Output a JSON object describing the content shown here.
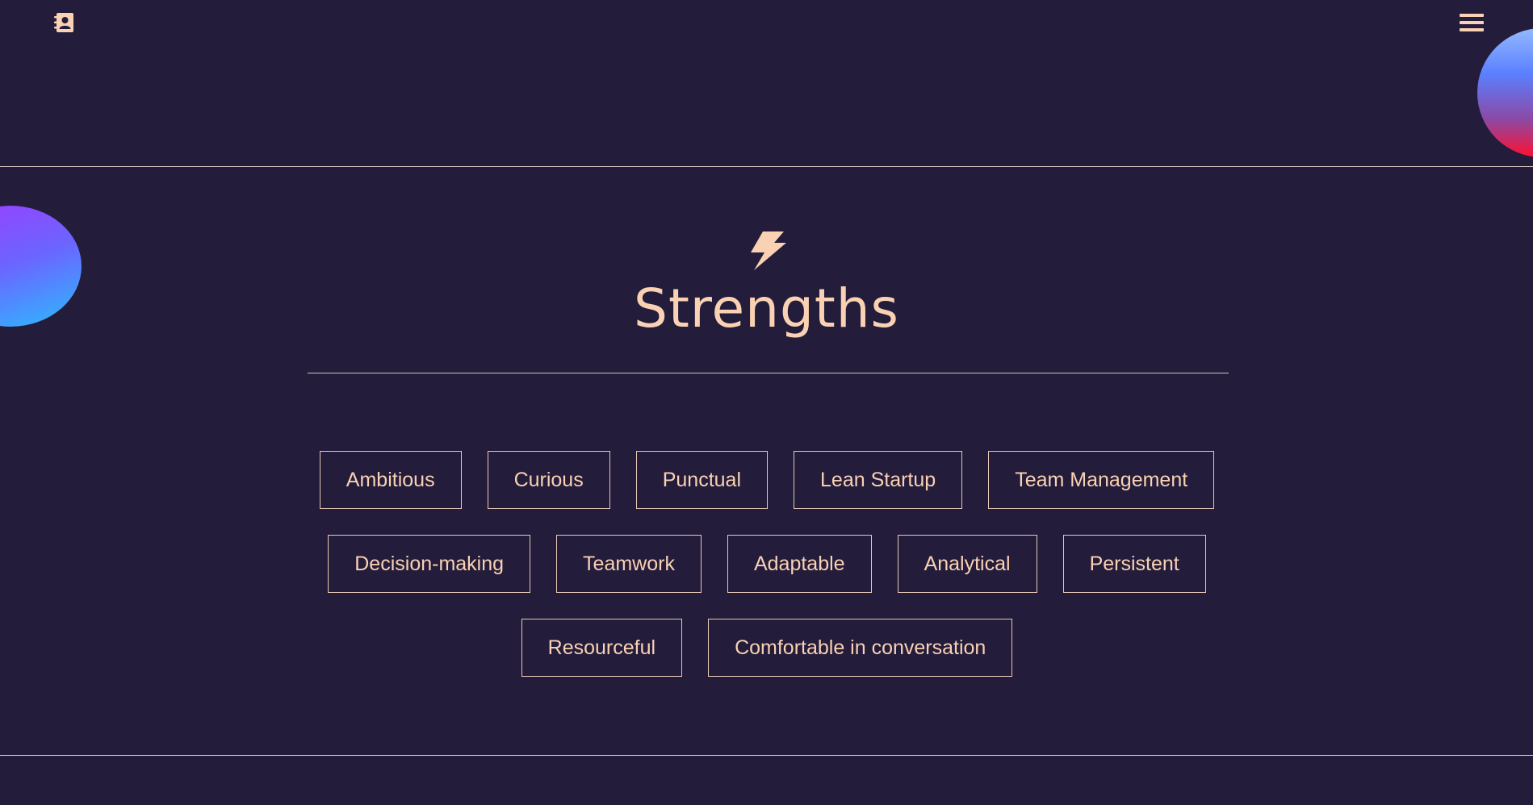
{
  "header": {
    "contacts_icon": "contact-book-icon",
    "menu_icon": "hamburger-menu-icon"
  },
  "strengths": {
    "icon": "lightning-bolt-icon",
    "title": "Strengths",
    "rows": [
      [
        "Ambitious",
        "Curious",
        "Punctual",
        "Lean Startup",
        "Team Management"
      ],
      [
        "Decision-making",
        "Teamwork",
        "Adaptable",
        "Analytical",
        "Persistent"
      ],
      [
        "Resourceful",
        "Comfortable in conversation"
      ]
    ]
  },
  "colors": {
    "background": "#231c3b",
    "accent": "#fad1b3",
    "divider": "#d9c3c0"
  }
}
